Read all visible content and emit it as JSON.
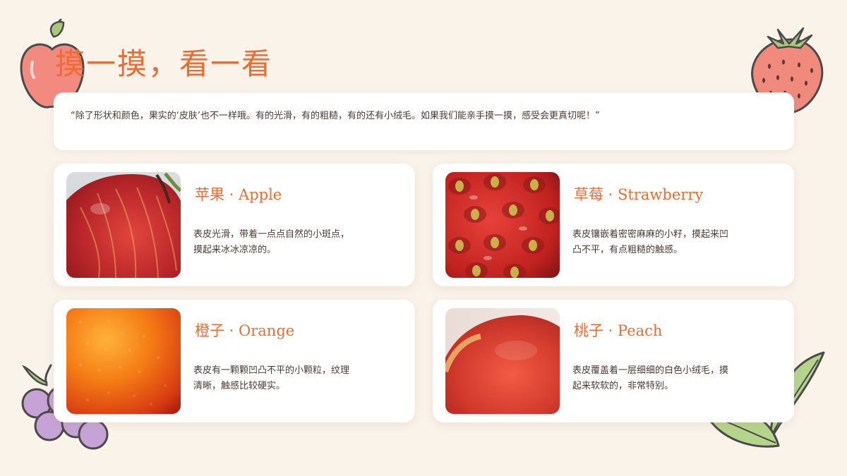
{
  "title": "摸一摸，看一看",
  "intro": "“除了形状和颜色，果实的‘皮肤’也不一样哦。有的光滑，有的粗糙，有的还有小绒毛。如果我们能亲手摸一摸，感受会更真切呢！”",
  "colors": {
    "accent": "#ef6b2e",
    "background": "#faf3ea",
    "card": "#ffffff",
    "body_text": "#4a3a33"
  },
  "cards": [
    {
      "name": "苹果 · Apple",
      "desc": "表皮光滑，带着一点点自然的小斑点，摸起来冰冰凉凉的。",
      "photo": "apple-skin-photo"
    },
    {
      "name": "草莓 · Strawberry",
      "desc": "表皮镶嵌着密密麻麻的小籽，摸起来凹凸不平，有点粗糙的触感。",
      "photo": "strawberry-skin-photo"
    },
    {
      "name": "橙子 · Orange",
      "desc": "表皮有一颗颗凹凸不平的小颗粒，纹理清晰，触感比较硬实。",
      "photo": "orange-skin-photo"
    },
    {
      "name": "桃子 · Peach",
      "desc": "表皮覆盖着一层细细的白色小绒毛，摸起来软软的，非常特别。",
      "photo": "peach-skin-photo"
    }
  ],
  "decorations": [
    "apple-icon",
    "strawberry-icon",
    "grapes-icon",
    "leaves-icon"
  ]
}
